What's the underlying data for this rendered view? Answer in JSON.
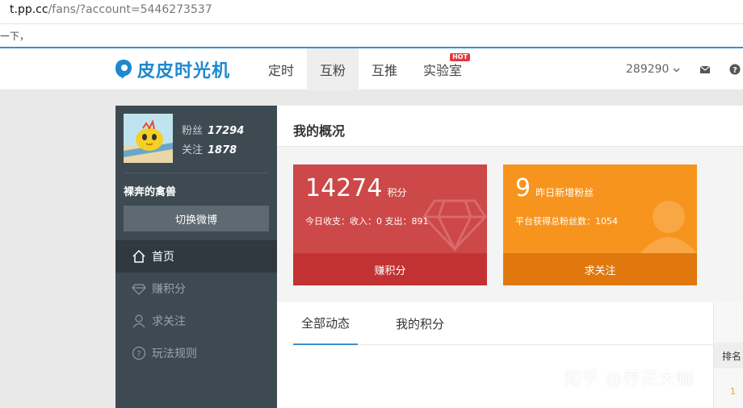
{
  "browser": {
    "url_host": "t.pp.cc",
    "url_path": "/fans/?account=5446273537"
  },
  "note_text": "一下，",
  "header": {
    "logo_text": "皮皮时光机",
    "nav": [
      {
        "label": "定时",
        "active": false
      },
      {
        "label": "互粉",
        "active": true
      },
      {
        "label": "互推",
        "active": false
      },
      {
        "label": "实验室",
        "active": false,
        "badge": "HOT"
      }
    ],
    "account": "289290",
    "icons": [
      "mail-icon",
      "help-icon"
    ]
  },
  "sidebar": {
    "fans_label": "粉丝",
    "fans_count": "17294",
    "follow_label": "关注",
    "follow_count": "1878",
    "username": "裸奔的禽兽",
    "switch_button": "切换微博",
    "menu": [
      {
        "label": "首页",
        "icon": "home-icon",
        "active": true
      },
      {
        "label": "赚积分",
        "icon": "diamond-icon",
        "active": false
      },
      {
        "label": "求关注",
        "icon": "person-icon",
        "active": false
      },
      {
        "label": "玩法规则",
        "icon": "question-icon",
        "active": false
      }
    ]
  },
  "main": {
    "title": "我的概况",
    "card_points": {
      "value": "14274",
      "unit": "积分",
      "detail": "今日收支：收入：0 支出：891",
      "button": "赚积分"
    },
    "card_fans": {
      "value": "9",
      "unit": "昨日新增粉丝",
      "detail": "平台获得总粉丝数：1054",
      "button": "求关注"
    },
    "tabs": [
      {
        "label": "全部动态",
        "active": true
      },
      {
        "label": "我的积分",
        "active": false
      }
    ],
    "rank_header": "排名",
    "rank_value": "1"
  },
  "watermark": "知乎 @养花大咖",
  "colors": {
    "accent": "#3d8fd1",
    "red_card": "#cd4848",
    "orange_card": "#f7941d",
    "sidebar": "#3e4a51"
  }
}
